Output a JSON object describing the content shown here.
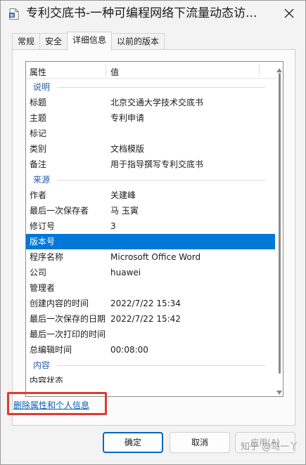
{
  "window": {
    "title": "专利交底书-一种可编程网络下流量动态访...",
    "app_icon": "word-document-icon",
    "close_icon": "close-icon"
  },
  "tabs": [
    {
      "label": "常规"
    },
    {
      "label": "安全"
    },
    {
      "label": "详细信息",
      "active": true
    },
    {
      "label": "以前的版本"
    }
  ],
  "list": {
    "header": {
      "property": "属性",
      "value": "值"
    },
    "rows": [
      {
        "type": "group",
        "key": "说明"
      },
      {
        "key": "标题",
        "value": "北京交通大学技术交底书"
      },
      {
        "key": "主题",
        "value": "专利申请"
      },
      {
        "key": "标记",
        "value": ""
      },
      {
        "key": "类别",
        "value": "文档模版"
      },
      {
        "key": "备注",
        "value": "用于指导撰写专利交底书"
      },
      {
        "type": "group",
        "key": "来源"
      },
      {
        "key": "作者",
        "value": "关建峰"
      },
      {
        "key": "最后一次保存者",
        "value": "马 玉寅"
      },
      {
        "key": "修订号",
        "value": "3"
      },
      {
        "key": "版本号",
        "value": "",
        "selected": true
      },
      {
        "key": "程序名称",
        "value": "Microsoft Office Word"
      },
      {
        "key": "公司",
        "value": "huawei"
      },
      {
        "key": "管理者",
        "value": ""
      },
      {
        "key": "创建内容的时间",
        "value": "2022/7/22 15:34"
      },
      {
        "key": "最后一次保存的日期",
        "value": "2022/7/22 15:42"
      },
      {
        "key": "最后一次打印的时间",
        "value": ""
      },
      {
        "key": "总编辑时间",
        "value": "00:08:00"
      },
      {
        "type": "group",
        "key": "内容"
      },
      {
        "key": "内容状态",
        "value": "",
        "partial": true
      }
    ]
  },
  "remove_link": "删除属性和个人信息",
  "buttons": {
    "ok": "确定",
    "cancel": "取消",
    "apply": "应用(A)"
  },
  "watermark": "知乎 @马一丫",
  "colors": {
    "selection": "#0078d7",
    "link": "#0b5fb7",
    "highlight": "#e03a2f",
    "group_header": "#2a5aa6"
  }
}
